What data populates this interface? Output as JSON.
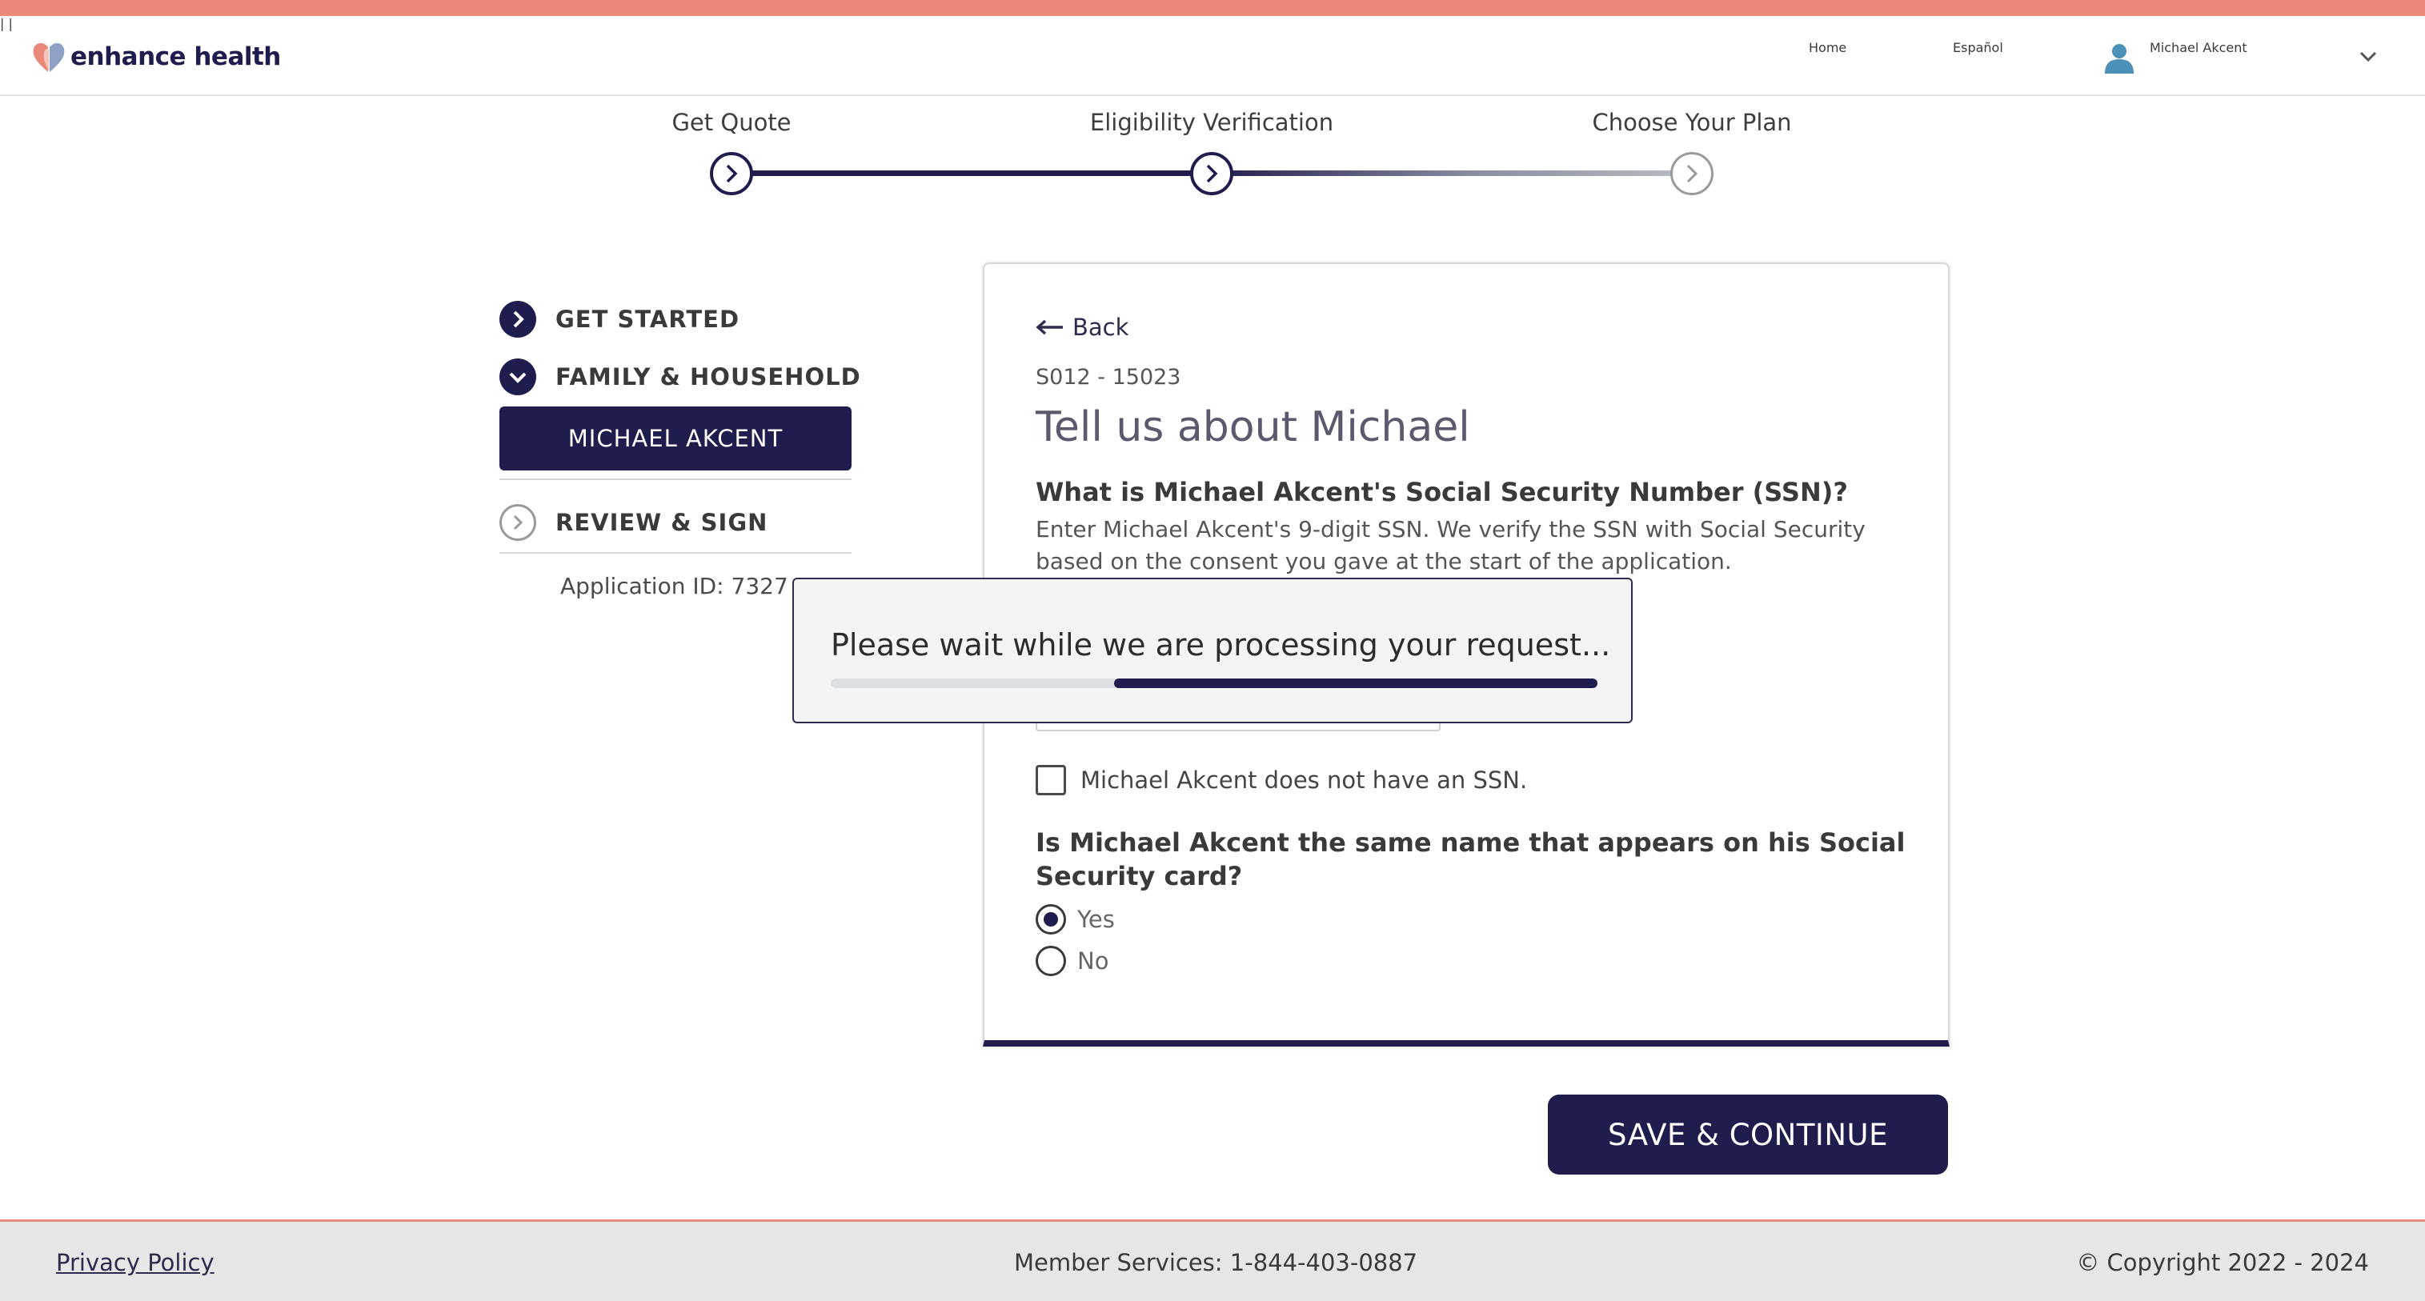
{
  "brand": {
    "name": "enhance health",
    "accent": "#e9897a",
    "primary": "#1f1d4e"
  },
  "header": {
    "nav": {
      "home": "Home",
      "language": "Español",
      "separator": "|",
      "user": "Michael Akcent"
    }
  },
  "stepper": {
    "steps": [
      {
        "label": "Get Quote",
        "state": "complete"
      },
      {
        "label": "Eligibility Verification",
        "state": "current"
      },
      {
        "label": "Choose Your Plan",
        "state": "upcoming"
      }
    ]
  },
  "sidebar": {
    "items": [
      {
        "label": "GET STARTED",
        "icon": "chevron-right-icon"
      },
      {
        "label": "FAMILY & HOUSEHOLD",
        "icon": "chevron-down-icon"
      },
      {
        "label": "MICHAEL AKCENT",
        "selected": true
      },
      {
        "label": "REVIEW & SIGN",
        "icon": "chevron-right-icon"
      }
    ],
    "application_id": "Application ID: 7327"
  },
  "form": {
    "back": "Back",
    "code": "S012 - 15023",
    "title": "Tell us about Michael",
    "ssn_question": "What is Michael Akcent's Social Security Number (SSN)?",
    "ssn_help": "Enter Michael Akcent's 9-digit SSN. We verify the SSN with Social Security based on the consent you gave at the start of the application.",
    "no_ssn_label": "Michael Akcent does not have an SSN.",
    "no_ssn_checked": false,
    "name_question": "Is Michael Akcent the same name that appears on his Social Security card?",
    "options": [
      {
        "label": "Yes",
        "selected": true
      },
      {
        "label": "No",
        "selected": false
      }
    ]
  },
  "modal": {
    "message": "Please wait while we are processing your request...",
    "progress_start": 0.37,
    "progress_end": 1.0
  },
  "actions": {
    "save": "SAVE & CONTINUE"
  },
  "footer": {
    "privacy": "Privacy Policy",
    "member_services": "Member Services: 1-844-403-0887",
    "copyright": "© Copyright 2022 - 2024"
  }
}
